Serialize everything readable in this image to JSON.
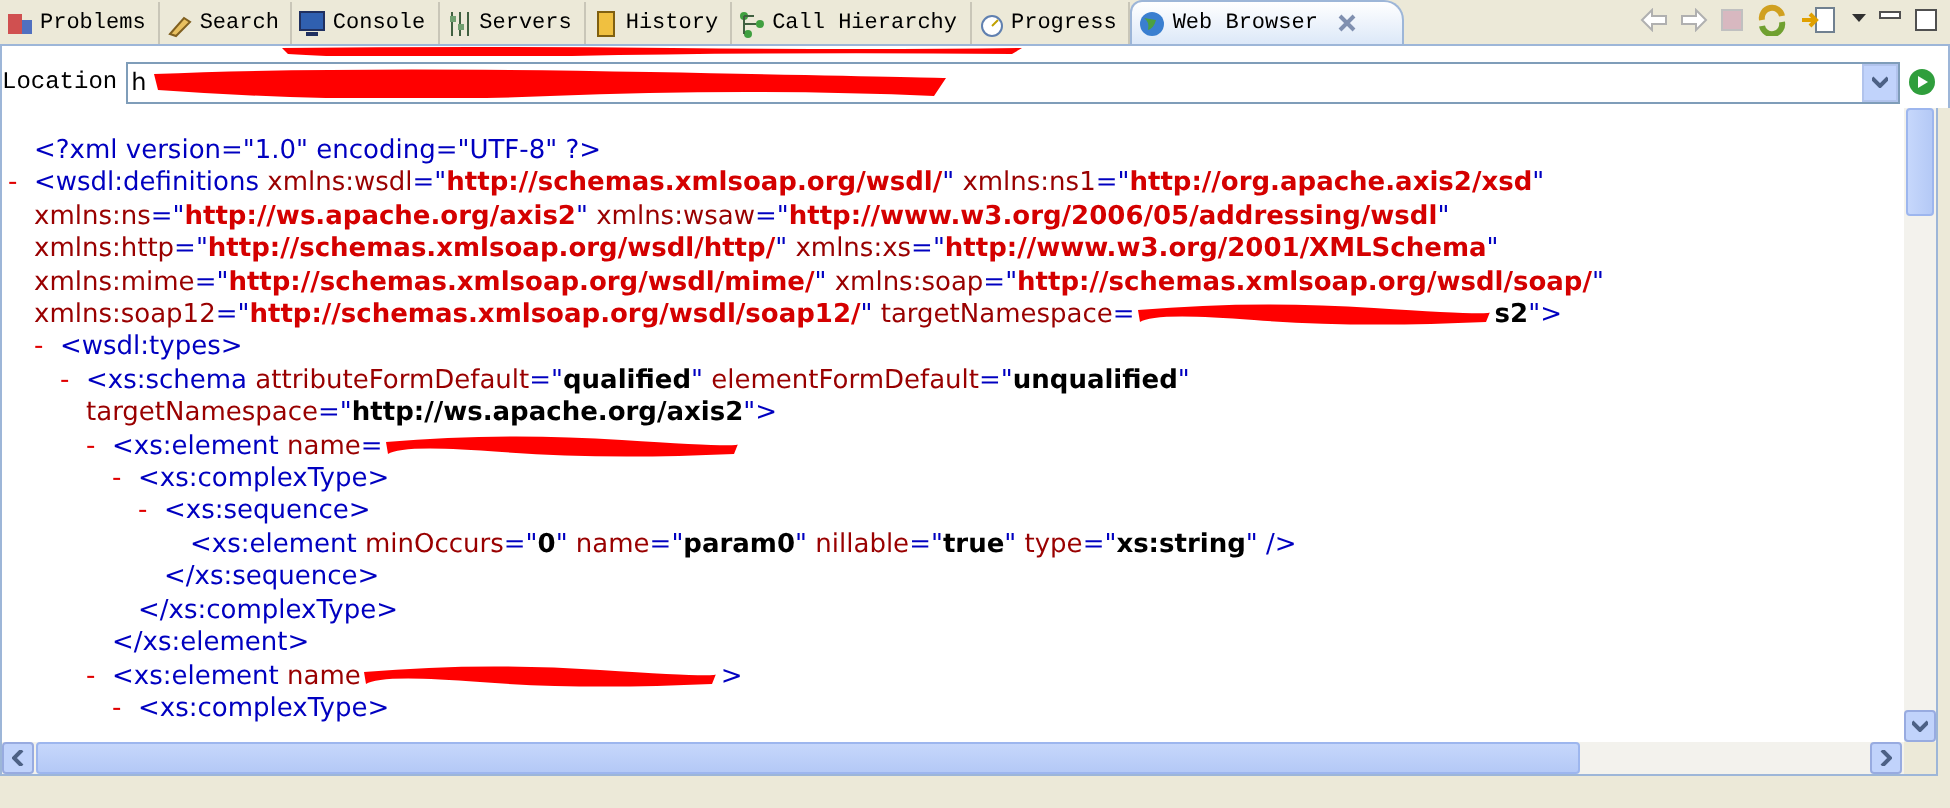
{
  "tabs": [
    {
      "label": "Problems",
      "selected": false
    },
    {
      "label": "Search",
      "selected": false
    },
    {
      "label": "Console",
      "selected": false
    },
    {
      "label": "Servers",
      "selected": false
    },
    {
      "label": "History",
      "selected": false
    },
    {
      "label": "Call Hierarchy",
      "selected": false
    },
    {
      "label": "Progress",
      "selected": false
    },
    {
      "label": "Web Browser",
      "selected": true,
      "closable": true
    }
  ],
  "location": {
    "label": "Location",
    "value": "h"
  },
  "document": {
    "nodes": [
      {
        "lines": [
          [
            {
              "kind": "m",
              "text": "<?xml version=\"1.0\" encoding=\"UTF-8\" ?>"
            }
          ]
        ]
      },
      {
        "toggle": "-",
        "lines": [
          [
            {
              "kind": "m",
              "text": "<wsdl:definitions"
            },
            {
              "kind": "a",
              "text": " xmlns:wsdl"
            },
            {
              "kind": "m",
              "text": "=\""
            },
            {
              "kind": "u",
              "text": "http://schemas.xmlsoap.org/wsdl/"
            },
            {
              "kind": "m",
              "text": "\""
            },
            {
              "kind": "a",
              "text": " xmlns:ns1"
            },
            {
              "kind": "m",
              "text": "=\""
            },
            {
              "kind": "u",
              "text": "http://org.apache.axis2/xsd"
            },
            {
              "kind": "m",
              "text": "\""
            }
          ],
          [
            {
              "kind": "a",
              "text": "xmlns:ns"
            },
            {
              "kind": "m",
              "text": "=\""
            },
            {
              "kind": "u",
              "text": "http://ws.apache.org/axis2"
            },
            {
              "kind": "m",
              "text": "\""
            },
            {
              "kind": "a",
              "text": " xmlns:wsaw"
            },
            {
              "kind": "m",
              "text": "=\""
            },
            {
              "kind": "u",
              "text": "http://www.w3.org/2006/05/addressing/wsdl"
            },
            {
              "kind": "m",
              "text": "\""
            }
          ],
          [
            {
              "kind": "a",
              "text": "xmlns:http"
            },
            {
              "kind": "m",
              "text": "=\""
            },
            {
              "kind": "u",
              "text": "http://schemas.xmlsoap.org/wsdl/http/"
            },
            {
              "kind": "m",
              "text": "\""
            },
            {
              "kind": "a",
              "text": " xmlns:xs"
            },
            {
              "kind": "m",
              "text": "=\""
            },
            {
              "kind": "u",
              "text": "http://www.w3.org/2001/XMLSchema"
            },
            {
              "kind": "m",
              "text": "\""
            }
          ],
          [
            {
              "kind": "a",
              "text": "xmlns:mime"
            },
            {
              "kind": "m",
              "text": "=\""
            },
            {
              "kind": "u",
              "text": "http://schemas.xmlsoap.org/wsdl/mime/"
            },
            {
              "kind": "m",
              "text": "\""
            },
            {
              "kind": "a",
              "text": " xmlns:soap"
            },
            {
              "kind": "m",
              "text": "=\""
            },
            {
              "kind": "u",
              "text": "http://schemas.xmlsoap.org/wsdl/soap/"
            },
            {
              "kind": "m",
              "text": "\""
            }
          ],
          [
            {
              "kind": "a",
              "text": "xmlns:soap12"
            },
            {
              "kind": "m",
              "text": "=\""
            },
            {
              "kind": "u",
              "text": "http://schemas.xmlsoap.org/wsdl/soap12/"
            },
            {
              "kind": "m",
              "text": "\""
            },
            {
              "kind": "a",
              "text": " targetNamespace"
            },
            {
              "kind": "m",
              "text": "="
            },
            {
              "kind": "redaction"
            },
            {
              "kind": "b",
              "text": "s2"
            },
            {
              "kind": "m",
              "text": "\">"
            }
          ]
        ],
        "children": [
          {
            "toggle": "-",
            "lines": [
              [
                {
                  "kind": "m",
                  "text": "<wsdl:types>"
                }
              ]
            ],
            "children": [
              {
                "toggle": "-",
                "lines": [
                  [
                    {
                      "kind": "m",
                      "text": "<xs:schema"
                    },
                    {
                      "kind": "a",
                      "text": " attributeFormDefault"
                    },
                    {
                      "kind": "m",
                      "text": "=\""
                    },
                    {
                      "kind": "b",
                      "text": "qualified"
                    },
                    {
                      "kind": "m",
                      "text": "\""
                    },
                    {
                      "kind": "a",
                      "text": " elementFormDefault"
                    },
                    {
                      "kind": "m",
                      "text": "=\""
                    },
                    {
                      "kind": "b",
                      "text": "unqualified"
                    },
                    {
                      "kind": "m",
                      "text": "\""
                    }
                  ],
                  [
                    {
                      "kind": "a",
                      "text": "targetNamespace"
                    },
                    {
                      "kind": "m",
                      "text": "=\""
                    },
                    {
                      "kind": "b",
                      "text": "http://ws.apache.org/axis2"
                    },
                    {
                      "kind": "m",
                      "text": "\">"
                    }
                  ]
                ],
                "children": [
                  {
                    "toggle": "-",
                    "lines": [
                      [
                        {
                          "kind": "m",
                          "text": "<xs:element"
                        },
                        {
                          "kind": "a",
                          "text": " name"
                        },
                        {
                          "kind": "m",
                          "text": "="
                        },
                        {
                          "kind": "redaction"
                        }
                      ]
                    ],
                    "children": [
                      {
                        "toggle": "-",
                        "lines": [
                          [
                            {
                              "kind": "m",
                              "text": "<xs:complexType>"
                            }
                          ]
                        ],
                        "children": [
                          {
                            "toggle": "-",
                            "lines": [
                              [
                                {
                                  "kind": "m",
                                  "text": "<xs:sequence>"
                                }
                              ]
                            ],
                            "children": [
                              {
                                "lines": [
                                  [
                                    {
                                      "kind": "m",
                                      "text": "<xs:element"
                                    },
                                    {
                                      "kind": "a",
                                      "text": " minOccurs"
                                    },
                                    {
                                      "kind": "m",
                                      "text": "=\""
                                    },
                                    {
                                      "kind": "b",
                                      "text": "0"
                                    },
                                    {
                                      "kind": "m",
                                      "text": "\""
                                    },
                                    {
                                      "kind": "a",
                                      "text": " name"
                                    },
                                    {
                                      "kind": "m",
                                      "text": "=\""
                                    },
                                    {
                                      "kind": "b",
                                      "text": "param0"
                                    },
                                    {
                                      "kind": "m",
                                      "text": "\""
                                    },
                                    {
                                      "kind": "a",
                                      "text": " nillable"
                                    },
                                    {
                                      "kind": "m",
                                      "text": "=\""
                                    },
                                    {
                                      "kind": "b",
                                      "text": "true"
                                    },
                                    {
                                      "kind": "m",
                                      "text": "\""
                                    },
                                    {
                                      "kind": "a",
                                      "text": " type"
                                    },
                                    {
                                      "kind": "m",
                                      "text": "=\""
                                    },
                                    {
                                      "kind": "b",
                                      "text": "xs:string"
                                    },
                                    {
                                      "kind": "m",
                                      "text": "\" />"
                                    }
                                  ]
                                ]
                              }
                            ],
                            "close": [
                              {
                                "kind": "m",
                                "text": "</xs:sequence>"
                              }
                            ]
                          }
                        ],
                        "close": [
                          {
                            "kind": "m",
                            "text": "</xs:complexType>"
                          }
                        ]
                      }
                    ],
                    "close": [
                      {
                        "kind": "m",
                        "text": "</xs:element>"
                      }
                    ]
                  },
                  {
                    "toggle": "-",
                    "lines": [
                      [
                        {
                          "kind": "m",
                          "text": "<xs:element"
                        },
                        {
                          "kind": "a",
                          "text": " name"
                        },
                        {
                          "kind": "redaction"
                        },
                        {
                          "kind": "m",
                          "text": ">"
                        }
                      ]
                    ],
                    "children": [
                      {
                        "toggle": "-",
                        "lines": [
                          [
                            {
                              "kind": "m",
                              "text": "<xs:complexType>"
                            }
                          ]
                        ]
                      }
                    ]
                  }
                ]
              }
            ]
          }
        ]
      }
    ]
  }
}
